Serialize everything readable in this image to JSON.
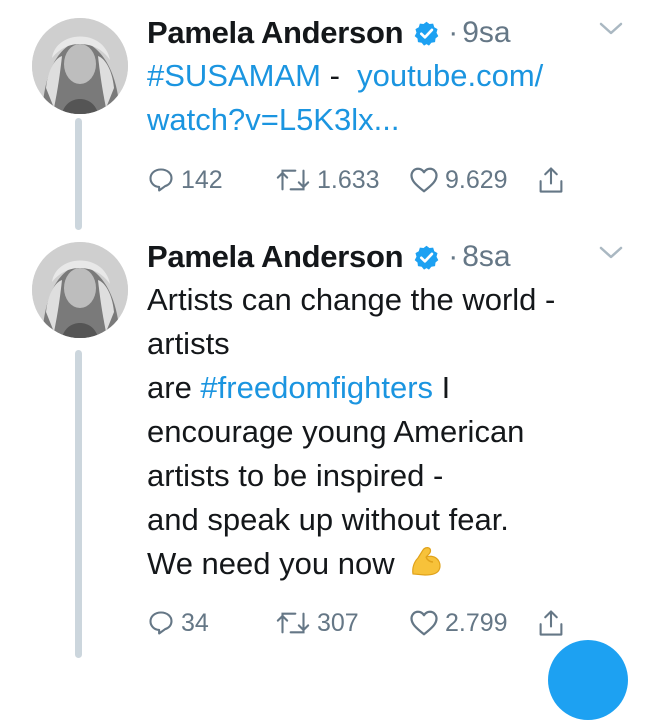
{
  "tweets": [
    {
      "author": "Pamela Anderson",
      "separator": "·",
      "time": "9sa",
      "text": {
        "hashtag": "#SUSAMAM",
        "dash": " - ",
        "link_line1": "youtube.com/",
        "link_line2": "watch?v=L5K3lx..."
      },
      "stats": {
        "replies": "142",
        "retweets": "1.633",
        "likes": "9.629"
      }
    },
    {
      "author": "Pamela Anderson",
      "separator": "·",
      "time": "8sa",
      "text": {
        "line1": "Artists can change the world -",
        "line2": "artists",
        "line3_pre": "are ",
        "line3_hashtag": "#freedomfighters",
        "line3_post": " I",
        "line4": "encourage young American",
        "line5": "artists to be inspired -",
        "line6": "and speak up without fear.",
        "line7": "We need you now",
        "emoji": "flexed-biceps"
      },
      "stats": {
        "replies": "34",
        "retweets": "307",
        "likes": "2.799"
      }
    }
  ],
  "colors": {
    "link": "#1b95e0",
    "meta": "#657786",
    "thread_line": "#ccd6dd",
    "verified": "#1da1f2"
  }
}
